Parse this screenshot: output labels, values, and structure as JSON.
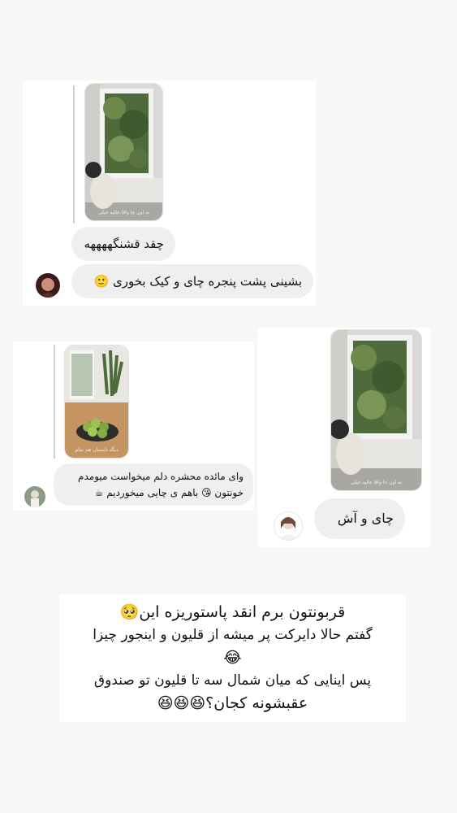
{
  "screenshot_top": {
    "story_caption": "نه اون جا واقا عالیه خیلی",
    "messages": [
      {
        "text": "چقد قشنگههههه"
      },
      {
        "text": "بشینی پشت پنجره چای و کیک بخوری 🙂"
      }
    ]
  },
  "screenshot_left": {
    "story_caption": "دیگه تابستان هم تمام",
    "message_line1": "وای مائده محشره دلم میخواست میومدم",
    "message_line2": "خونتون 😘 باهم ی چایی میخوردیم ☕"
  },
  "screenshot_right": {
    "story_caption": "نه اون جا واقا عالیه خیلی",
    "message": "چای و آش"
  },
  "caption": {
    "line1": "قربونتون برم انقد پاستوریزه این🥺",
    "line2": "گفتم حالا دایرکت پر میشه از قلیون و اینجور چیزا",
    "line3": "😂",
    "line4": "پس اینایی که میان شمال سه تا قلیون تو صندوق",
    "line5": "عقبشونه کجان؟😆😆😆"
  },
  "colors": {
    "page_bg": "#f7f7f7",
    "card_bg": "#ffffff",
    "bubble_bg": "#efefef",
    "text": "#111111"
  }
}
